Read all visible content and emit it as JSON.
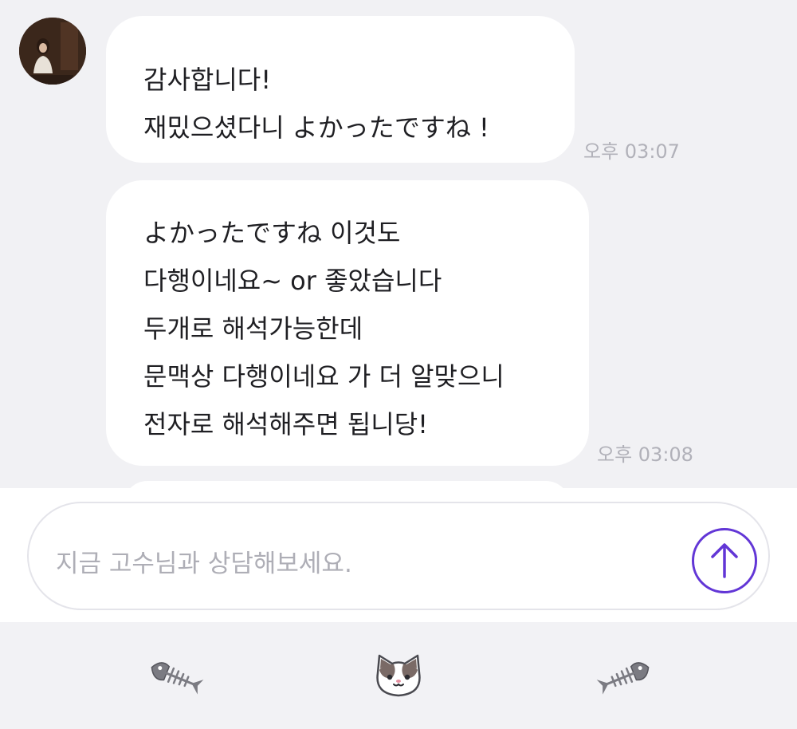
{
  "messages": [
    {
      "lines": [
        "감사합니다!",
        "재밌으셨다니 よかったですね !"
      ],
      "time": "오후 03:07"
    },
    {
      "lines": [
        "よかったですね 이것도",
        "다행이네요~ or 좋았습니다",
        "두개로 해석가능한데",
        "문맥상 다행이네요 가 더 알맞으니",
        "전자로 해석해주면 됩니당!"
      ],
      "time": "오후 03:08"
    }
  ],
  "composer": {
    "placeholder": "지금 고수님과 상담해보세요.",
    "send_icon": "arrow-up-circle-icon"
  },
  "bottom_bar": {
    "icons": [
      "fish-bone-icon",
      "cat-face-icon",
      "fish-bone-icon"
    ]
  },
  "colors": {
    "accent": "#6236d6",
    "bubble": "#ffffff",
    "chat_background": "#f1f1f4",
    "timestamp": "#b1b1b9"
  }
}
